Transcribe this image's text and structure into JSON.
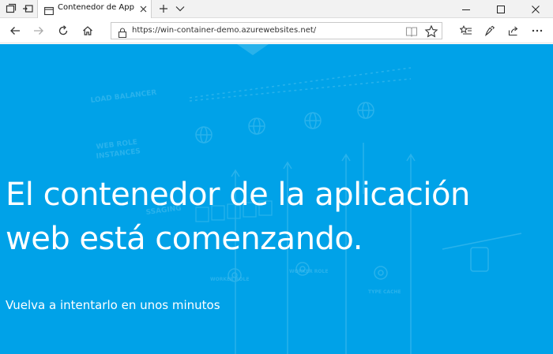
{
  "browser": {
    "tab": {
      "title": "Contenedor de App Se"
    },
    "address": {
      "url": "https://win-container-demo.azurewebsites.net/"
    }
  },
  "page": {
    "background_color": "#00a2e8",
    "headline": "El contenedor de la aplicación web está comenzando.",
    "subline": "Vuelva a intentarlo en unos minutos"
  },
  "background_diagram": {
    "labels": [
      "LOAD BALANCER",
      "WEB ROLE",
      "INSTANCES",
      "SSAGING",
      "WORKER ROLE",
      "WORKER ROLE",
      "TYPE CACHE"
    ]
  },
  "icons": {
    "tab_actions": "tab-actions-icon",
    "set_aside": "set-aside-tabs-icon",
    "favicon": "page-favicon-icon",
    "close": "close-icon",
    "new_tab": "plus-icon",
    "tab_list": "chevron-down-icon",
    "minimize": "minimize-icon",
    "maximize": "maximize-icon",
    "window_close": "window-close-icon",
    "back": "back-arrow-icon",
    "forward": "forward-arrow-icon",
    "refresh": "refresh-icon",
    "home": "home-icon",
    "lock": "lock-icon",
    "reading_view": "reading-view-icon",
    "favorite": "star-icon",
    "favorites_hub": "favorites-hub-icon",
    "notes": "pen-icon",
    "share": "share-icon",
    "more": "more-dots-icon"
  }
}
